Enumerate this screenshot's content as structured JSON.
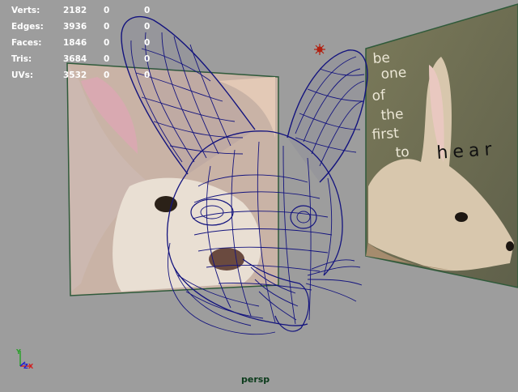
{
  "hud": {
    "rows": [
      {
        "label": "Verts:",
        "total": "2182",
        "selected": "0",
        "extra": "0"
      },
      {
        "label": "Edges:",
        "total": "3936",
        "selected": "0",
        "extra": "0"
      },
      {
        "label": "Faces:",
        "total": "1846",
        "selected": "0",
        "extra": "0"
      },
      {
        "label": "Tris:",
        "total": "3684",
        "selected": "0",
        "extra": "0"
      },
      {
        "label": "UVs:",
        "total": "3532",
        "selected": "0",
        "extra": "0"
      }
    ]
  },
  "camera_label": "persp",
  "axis": {
    "x": "X",
    "y": "Y",
    "z": "Z"
  },
  "right_plane_text": {
    "words": [
      "be",
      "one",
      "of",
      "the",
      "first",
      "to",
      "hear"
    ]
  },
  "colors": {
    "viewport_bg": "#9d9d9d",
    "wireframe": "#13137e",
    "plane_border": "#2f5a3a",
    "light": "#b22010"
  },
  "icons": [
    "axis-gizmo-icon",
    "point-light-icon"
  ]
}
